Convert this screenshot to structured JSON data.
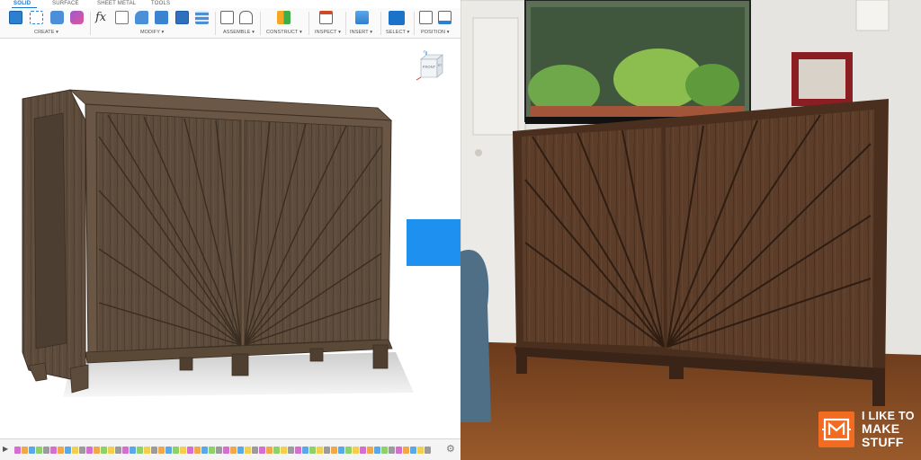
{
  "cad": {
    "workspace_tabs": [
      "SOLID",
      "SURFACE",
      "SHEET METAL",
      "TOOLS"
    ],
    "ribbon_groups": [
      "CREATE ▾",
      "MODIFY ▾",
      "ASSEMBLE ▾",
      "CONSTRUCT ▾",
      "INSPECT ▾",
      "INSERT ▾",
      "SELECT ▾",
      "POSITION ▾"
    ],
    "fx_label": "fx",
    "viewcube": {
      "front_label": "FRONT",
      "right_label": "RT",
      "axis_label": "Z"
    },
    "timeline": {
      "play_label": "▶",
      "gear_label": "⚙"
    }
  },
  "logo": {
    "lines": [
      "I LIKE TO",
      "MAKE",
      "STUFF"
    ]
  },
  "colors": {
    "accent_blue": "#1a73c8",
    "arrow_blue": "#1e90f0",
    "cabinet_wood": "#5a4a3a",
    "photo_wood": "#5e3f2c",
    "logo_orange": "#f26b21"
  }
}
